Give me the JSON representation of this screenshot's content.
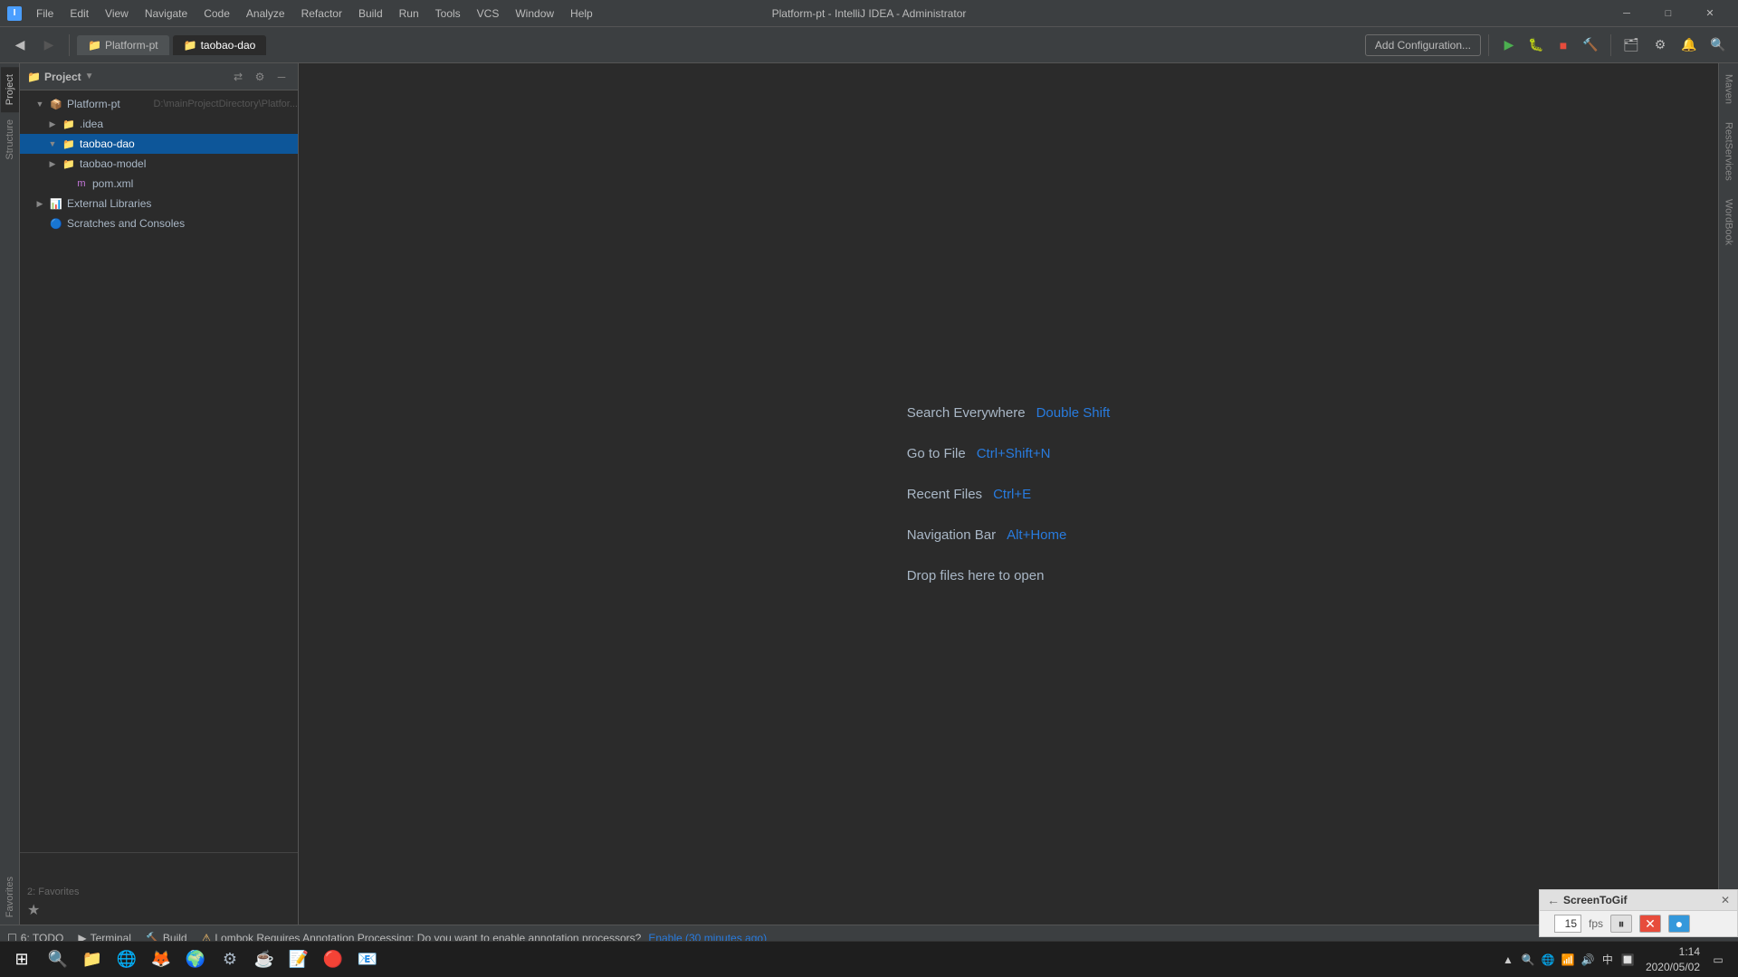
{
  "window": {
    "title": "Platform-pt - IntelliJ IDEA - Administrator"
  },
  "titlebar": {
    "menus": [
      "File",
      "Edit",
      "View",
      "Navigate",
      "Code",
      "Analyze",
      "Refactor",
      "Build",
      "Run",
      "Tools",
      "VCS",
      "Window",
      "Help"
    ],
    "win_controls": [
      "─",
      "□",
      "✕"
    ]
  },
  "toolbar": {
    "active_tab": "taobao-dao",
    "tabs": [
      "Platform-pt",
      "taobao-dao"
    ],
    "add_config_label": "Add Configuration...",
    "back_label": "◀",
    "forward_label": "▶"
  },
  "project_panel": {
    "title": "Project",
    "tree": [
      {
        "id": "platform-pt",
        "label": "Platform-pt",
        "path": "D:\\mainProjectDirectory\\Platfor...",
        "indent": 0,
        "type": "project",
        "arrow": "▼",
        "selected": false
      },
      {
        "id": "idea",
        "label": ".idea",
        "path": "",
        "indent": 1,
        "type": "folder",
        "arrow": "▶",
        "selected": false
      },
      {
        "id": "taobao-dao",
        "label": "taobao-dao",
        "path": "",
        "indent": 1,
        "type": "folder",
        "arrow": "▼",
        "selected": true
      },
      {
        "id": "taobao-model",
        "label": "taobao-model",
        "path": "",
        "indent": 1,
        "type": "folder",
        "arrow": "▶",
        "selected": false
      },
      {
        "id": "pom-xml",
        "label": "pom.xml",
        "path": "",
        "indent": 2,
        "type": "pom",
        "arrow": "",
        "selected": false
      },
      {
        "id": "external-libs",
        "label": "External Libraries",
        "path": "",
        "indent": 0,
        "type": "ext",
        "arrow": "▶",
        "selected": false
      },
      {
        "id": "scratches",
        "label": "Scratches and Consoles",
        "path": "",
        "indent": 0,
        "type": "scratch",
        "arrow": "",
        "selected": false
      }
    ]
  },
  "editor": {
    "search_everywhere_label": "Search Everywhere",
    "search_everywhere_shortcut": "Double Shift",
    "go_to_file_label": "Go to File",
    "go_to_file_shortcut": "Ctrl+Shift+N",
    "recent_files_label": "Recent Files",
    "recent_files_shortcut": "Ctrl+E",
    "navigation_bar_label": "Navigation Bar",
    "navigation_bar_shortcut": "Alt+Home",
    "drop_files_label": "Drop files here to open"
  },
  "vertical_tabs_left": [
    "Project",
    "Structure",
    "Favorites"
  ],
  "right_sidebar_tabs": [
    "Maven",
    "RestServices",
    "WordBook"
  ],
  "status_bar": {
    "todo_label": "6: TODO",
    "terminal_label": "Terminal",
    "build_label": "Build",
    "warning_text": "Lombok Requires Annotation Processing: Do you want to enable annotation processors?",
    "warning_link": "Enable (30 minutes ago)"
  },
  "screentogif": {
    "title": "ScreenToGif",
    "fps": "15",
    "fps_unit": "fps"
  },
  "taskbar": {
    "time": "1:14",
    "date": "2020/05/02",
    "tray_icons": [
      "🔍",
      "📶",
      "🔊",
      "⌨",
      "🕐"
    ]
  }
}
